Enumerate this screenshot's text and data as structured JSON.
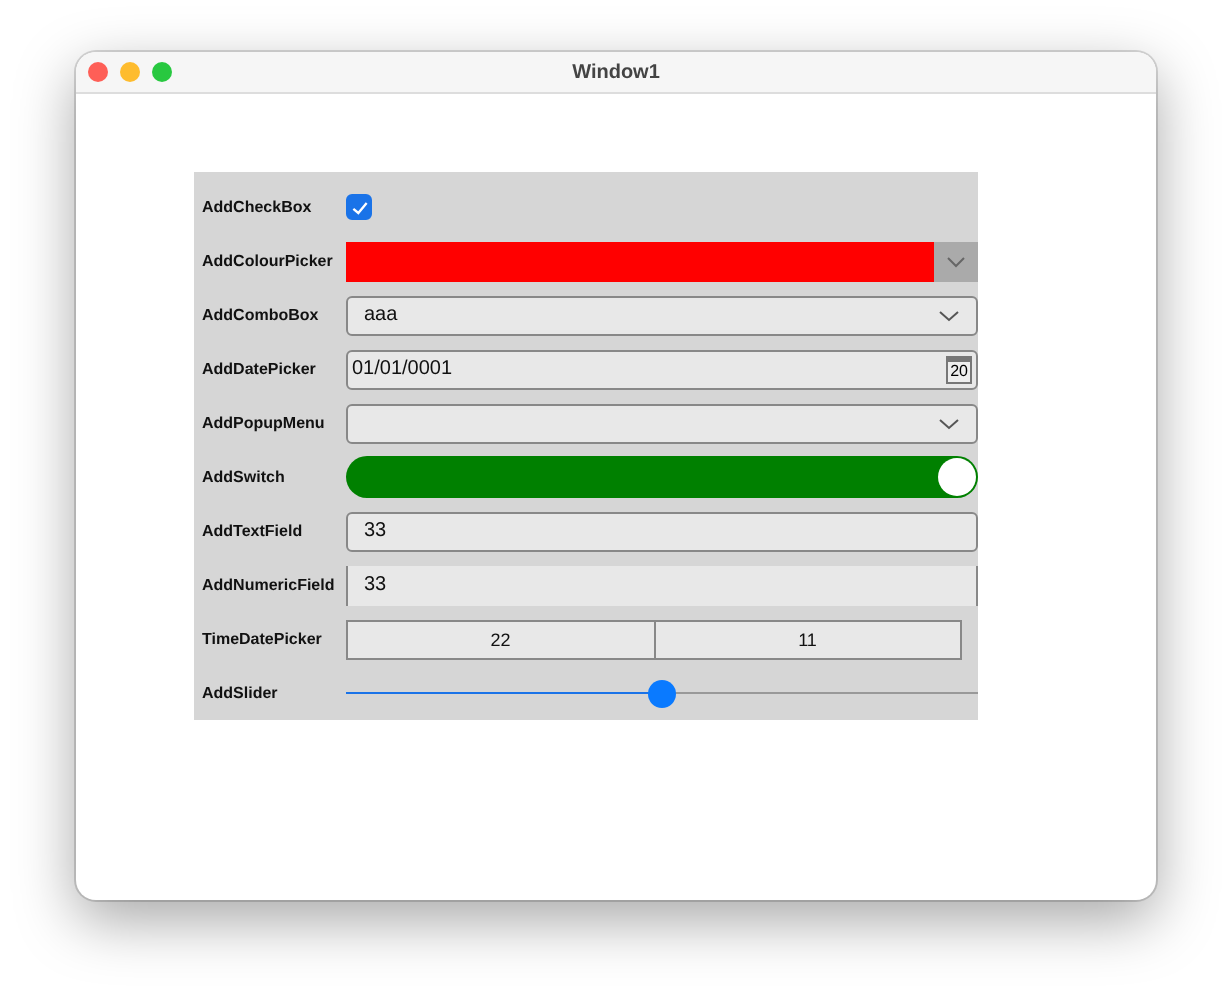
{
  "window": {
    "title": "Window1"
  },
  "rows": [
    {
      "label": "AddCheckBox",
      "kind": "checkbox",
      "checked": true
    },
    {
      "label": "AddColourPicker",
      "kind": "colour",
      "color": "#ff0000"
    },
    {
      "label": "AddComboBox",
      "kind": "combo",
      "value": "aaa"
    },
    {
      "label": "AddDatePicker",
      "kind": "date",
      "value": "01/01/0001",
      "calendar_day": "20"
    },
    {
      "label": "AddPopupMenu",
      "kind": "popup"
    },
    {
      "label": "AddSwitch",
      "kind": "switch",
      "on": true
    },
    {
      "label": "AddTextField",
      "kind": "text",
      "value": "33"
    },
    {
      "label": "AddNumericField",
      "kind": "numeric",
      "value": "33"
    },
    {
      "label": "TimeDatePicker",
      "kind": "timedate",
      "segments": [
        "22",
        "11"
      ]
    },
    {
      "label": "AddSlider",
      "kind": "slider",
      "level": 0.5
    }
  ]
}
